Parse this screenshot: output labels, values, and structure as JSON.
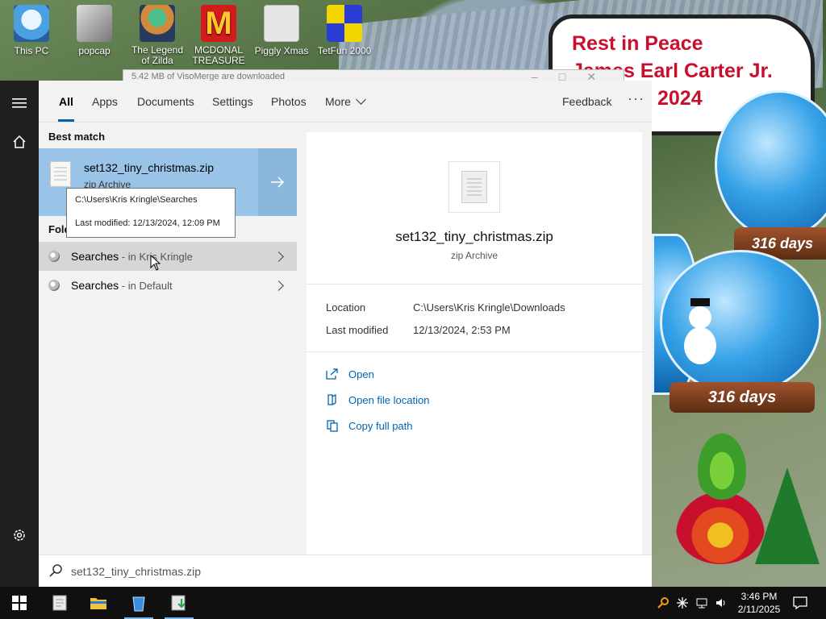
{
  "desktop": {
    "icons": [
      {
        "label": "This PC"
      },
      {
        "label": "popcap"
      },
      {
        "label": "The Legend of Zilda"
      },
      {
        "label": "MCDONAL TREASURE"
      },
      {
        "label": "Piggly Xmas"
      },
      {
        "label": "TetFun 2000"
      }
    ],
    "sign": {
      "line1": "Rest in Peace",
      "line2": "James Earl Carter Jr.",
      "line3": "2024"
    },
    "globe_top_days": "316 days",
    "globe_bottom_days": "316 days"
  },
  "bg_window": {
    "title": "5.42 MB of VisoMerge are downloaded"
  },
  "tabs": [
    {
      "label": "All",
      "active": true
    },
    {
      "label": "Apps"
    },
    {
      "label": "Documents"
    },
    {
      "label": "Settings"
    },
    {
      "label": "Photos"
    },
    {
      "label": "More"
    }
  ],
  "feedback": "Feedback",
  "more_options": "···",
  "best_match": {
    "heading": "Best match",
    "name": "set132_tiny_christmas.zip",
    "type": "zip Archive"
  },
  "tooltip": {
    "path": "C:\\Users\\Kris Kringle\\Searches",
    "modified": "Last modified: 12/13/2024, 12:09 PM"
  },
  "folders": {
    "heading": "Folders",
    "items": [
      {
        "name": "Searches",
        "sub": " - in Kris Kringle"
      },
      {
        "name": "Searches",
        "sub": " - in Default"
      }
    ]
  },
  "preview": {
    "name": "set132_tiny_christmas.zip",
    "type": "zip Archive",
    "location_label": "Location",
    "location_value": "C:\\Users\\Kris Kringle\\Downloads",
    "modified_label": "Last modified",
    "modified_value": "12/13/2024, 2:53 PM",
    "actions": [
      {
        "label": "Open"
      },
      {
        "label": "Open file location"
      },
      {
        "label": "Copy full path"
      }
    ]
  },
  "search": {
    "query": "set132_tiny_christmas.zip"
  },
  "taskbar": {
    "time": "3:46 PM",
    "date": "2/11/2025"
  },
  "colors": {
    "accent": "#0063b1",
    "best_match_bg": "#99c4e8",
    "rail_bg": "#1f1f1f",
    "taskbar_bg": "#101010",
    "sign_text": "#c8102e"
  }
}
